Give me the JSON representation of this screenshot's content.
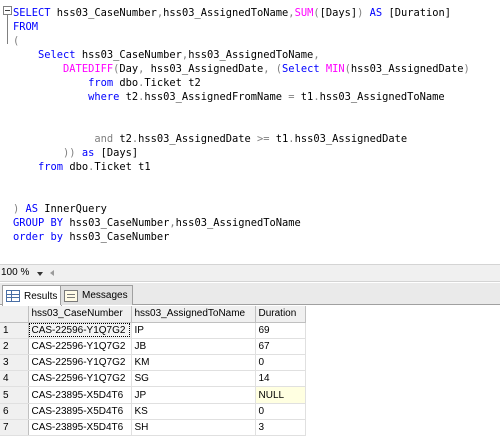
{
  "query_lines": [
    [
      {
        "t": "SELECT",
        "c": "kw"
      },
      {
        "t": " hss03_CaseNumber",
        "c": "txt"
      },
      {
        "t": ",",
        "c": "op"
      },
      {
        "t": "hss03_AssignedToName",
        "c": "txt"
      },
      {
        "t": ",",
        "c": "op"
      },
      {
        "t": "SUM",
        "c": "fn"
      },
      {
        "t": "(",
        "c": "op"
      },
      {
        "t": "[Days]",
        "c": "txt"
      },
      {
        "t": ")",
        "c": "op"
      },
      {
        "t": " AS ",
        "c": "kw"
      },
      {
        "t": "[Duration]",
        "c": "txt"
      }
    ],
    [
      {
        "t": "FROM",
        "c": "kw"
      }
    ],
    [
      {
        "t": "(",
        "c": "op"
      }
    ],
    [
      {
        "t": "    Select ",
        "c": "kw"
      },
      {
        "t": "hss03_CaseNumber",
        "c": "txt"
      },
      {
        "t": ",",
        "c": "op"
      },
      {
        "t": "hss03_AssignedToName",
        "c": "txt"
      },
      {
        "t": ",",
        "c": "op"
      }
    ],
    [
      {
        "t": "        DATEDIFF",
        "c": "fn"
      },
      {
        "t": "(",
        "c": "op"
      },
      {
        "t": "Day",
        "c": "txt"
      },
      {
        "t": ", ",
        "c": "op"
      },
      {
        "t": "hss03_AssignedDate",
        "c": "txt"
      },
      {
        "t": ", (",
        "c": "op"
      },
      {
        "t": "Select ",
        "c": "kw"
      },
      {
        "t": "MIN",
        "c": "fn"
      },
      {
        "t": "(",
        "c": "op"
      },
      {
        "t": "hss03_AssignedDate",
        "c": "txt"
      },
      {
        "t": ")",
        "c": "op"
      }
    ],
    [
      {
        "t": "            from ",
        "c": "kw"
      },
      {
        "t": "dbo",
        "c": "txt"
      },
      {
        "t": ".",
        "c": "op"
      },
      {
        "t": "Ticket t2",
        "c": "txt"
      }
    ],
    [
      {
        "t": "            where ",
        "c": "kw"
      },
      {
        "t": "t2",
        "c": "txt"
      },
      {
        "t": ".",
        "c": "op"
      },
      {
        "t": "hss03_AssignedFromName ",
        "c": "txt"
      },
      {
        "t": "= ",
        "c": "op"
      },
      {
        "t": "t1",
        "c": "txt"
      },
      {
        "t": ".",
        "c": "op"
      },
      {
        "t": "hss03_AssignedToName",
        "c": "txt"
      }
    ],
    [],
    [],
    [
      {
        "t": "             and ",
        "c": "op"
      },
      {
        "t": "t2",
        "c": "txt"
      },
      {
        "t": ".",
        "c": "op"
      },
      {
        "t": "hss03_AssignedDate ",
        "c": "txt"
      },
      {
        "t": ">= ",
        "c": "op"
      },
      {
        "t": "t1",
        "c": "txt"
      },
      {
        "t": ".",
        "c": "op"
      },
      {
        "t": "hss03_AssignedDate",
        "c": "txt"
      }
    ],
    [
      {
        "t": "        )) ",
        "c": "op"
      },
      {
        "t": "as ",
        "c": "kw"
      },
      {
        "t": "[Days]",
        "c": "txt"
      }
    ],
    [
      {
        "t": "    from ",
        "c": "kw"
      },
      {
        "t": "dbo",
        "c": "txt"
      },
      {
        "t": ".",
        "c": "op"
      },
      {
        "t": "Ticket t1",
        "c": "txt"
      }
    ],
    [],
    [],
    [
      {
        "t": ") ",
        "c": "op"
      },
      {
        "t": "AS ",
        "c": "kw"
      },
      {
        "t": "InnerQuery",
        "c": "txt"
      }
    ],
    [
      {
        "t": "GROUP BY ",
        "c": "kw"
      },
      {
        "t": "hss03_CaseNumber",
        "c": "txt"
      },
      {
        "t": ",",
        "c": "op"
      },
      {
        "t": "hss03_AssignedToName",
        "c": "txt"
      }
    ],
    [
      {
        "t": "order by ",
        "c": "kw"
      },
      {
        "t": "hss03_CaseNumber",
        "c": "txt"
      }
    ]
  ],
  "status": {
    "zoom": "100 %"
  },
  "tabs": {
    "results_label": "Results",
    "messages_label": "Messages"
  },
  "results": {
    "columns": [
      "hss03_CaseNumber",
      "hss03_AssignedToName",
      "Duration"
    ],
    "rows": [
      {
        "num": "1",
        "case": "CAS-22596-Y1Q7G2",
        "name": "IP",
        "duration": "69"
      },
      {
        "num": "2",
        "case": "CAS-22596-Y1Q7G2",
        "name": "JB",
        "duration": "67"
      },
      {
        "num": "3",
        "case": "CAS-22596-Y1Q7G2",
        "name": "KM",
        "duration": "0"
      },
      {
        "num": "4",
        "case": "CAS-22596-Y1Q7G2",
        "name": "SG",
        "duration": "14"
      },
      {
        "num": "5",
        "case": "CAS-23895-X5D4T6",
        "name": "JP",
        "duration": "NULL"
      },
      {
        "num": "6",
        "case": "CAS-23895-X5D4T6",
        "name": "KS",
        "duration": "0"
      },
      {
        "num": "7",
        "case": "CAS-23895-X5D4T6",
        "name": "SH",
        "duration": "3"
      }
    ]
  }
}
